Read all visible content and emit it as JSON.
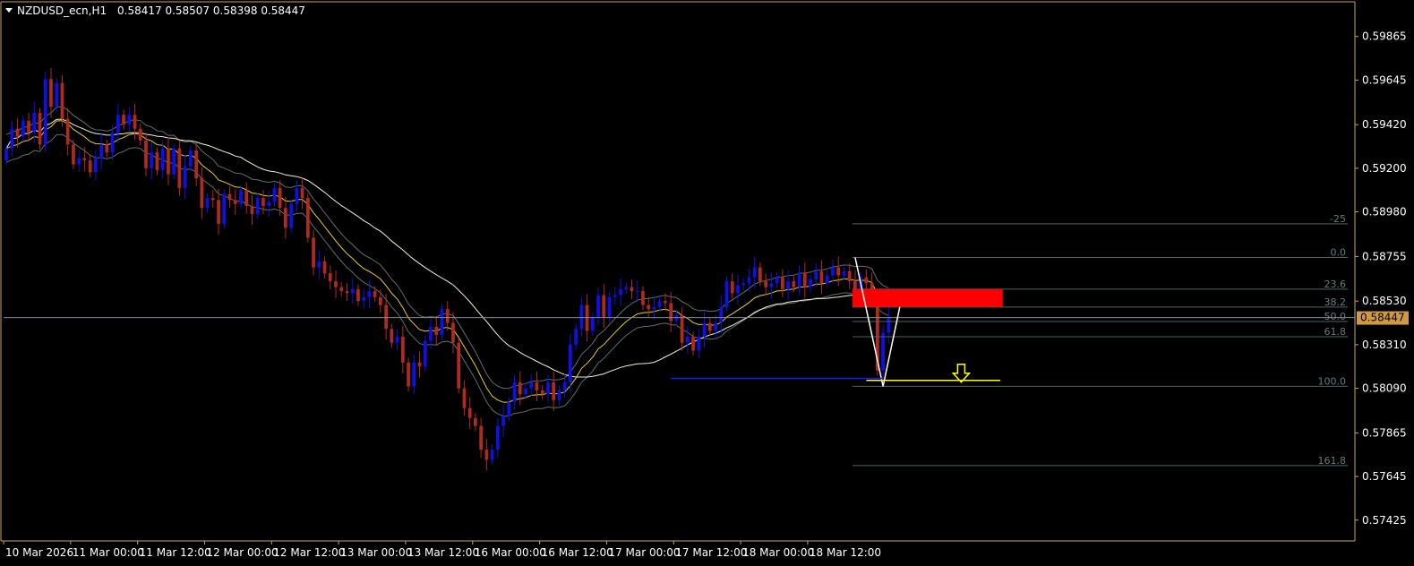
{
  "header": {
    "symbol": "NZDUSD_ecn,H1",
    "ohlc": "0.58417 0.58507 0.58398 0.58447"
  },
  "current_price_label": "0.58447",
  "colors": {
    "background": "#000000",
    "frame": "#c8a85a",
    "bull_candle": "#1010e6",
    "bear_candle": "#b02a22",
    "ma_fast": "#e8cf1e",
    "ma_slow": "#f3f0d8",
    "band": "#5f6f6a",
    "fib": "#4d6666",
    "zone": "#ff0000",
    "arrow": "#ffff00",
    "range_line": "#1a1aff",
    "price_tag_bg": "#d09a42"
  },
  "chart_data": {
    "type": "candlestick",
    "title": "NZDUSD_ecn,H1",
    "timeframe": "H1",
    "ylim": [
      0.5732,
      0.6004
    ],
    "y_ticks": [
      "0.59865",
      "0.59645",
      "0.59420",
      "0.59200",
      "0.58980",
      "0.58755",
      "0.58530",
      "0.58310",
      "0.58090",
      "0.57865",
      "0.57645",
      "0.57425"
    ],
    "x_ticks": [
      "10 Mar 2026",
      "11 Mar 00:00",
      "11 Mar 12:00",
      "12 Mar 00:00",
      "12 Mar 12:00",
      "13 Mar 00:00",
      "13 Mar 12:00",
      "16 Mar 00:00",
      "16 Mar 12:00",
      "17 Mar 00:00",
      "17 Mar 12:00",
      "18 Mar 00:00",
      "18 Mar 12:00"
    ],
    "x_tick_bars": [
      0,
      12,
      24,
      36,
      48,
      60,
      72,
      84,
      96,
      108,
      120,
      132,
      144
    ],
    "closes": [
      0.593,
      0.594,
      0.5936,
      0.5944,
      0.5938,
      0.5948,
      0.5932,
      0.5965,
      0.5951,
      0.5963,
      0.5945,
      0.5932,
      0.5922,
      0.5925,
      0.5924,
      0.5918,
      0.5925,
      0.5932,
      0.5928,
      0.5938,
      0.5947,
      0.5942,
      0.5947,
      0.594,
      0.5934,
      0.592,
      0.5928,
      0.5919,
      0.593,
      0.5917,
      0.593,
      0.591,
      0.5921,
      0.5929,
      0.5915,
      0.59,
      0.5905,
      0.5904,
      0.5892,
      0.5907,
      0.5904,
      0.5902,
      0.5909,
      0.5901,
      0.5897,
      0.5905,
      0.5901,
      0.5903,
      0.591,
      0.59,
      0.589,
      0.5902,
      0.591,
      0.5905,
      0.5885,
      0.587,
      0.5873,
      0.5867,
      0.5863,
      0.586,
      0.5858,
      0.5857,
      0.5859,
      0.5853,
      0.5855,
      0.5858,
      0.5855,
      0.5851,
      0.5839,
      0.5832,
      0.5835,
      0.5822,
      0.581,
      0.5822,
      0.582,
      0.5833,
      0.584,
      0.5836,
      0.5849,
      0.5842,
      0.5832,
      0.5809,
      0.5799,
      0.5794,
      0.579,
      0.5778,
      0.5773,
      0.5778,
      0.579,
      0.5795,
      0.5802,
      0.5812,
      0.5806,
      0.5809,
      0.5812,
      0.5808,
      0.5806,
      0.5812,
      0.5803,
      0.5808,
      0.5812,
      0.5831,
      0.5839,
      0.5851,
      0.5838,
      0.5845,
      0.5856,
      0.5845,
      0.5855,
      0.5856,
      0.5859,
      0.586,
      0.5858,
      0.5858,
      0.5851,
      0.5849,
      0.585,
      0.5853,
      0.5852,
      0.5843,
      0.5846,
      0.5832,
      0.5835,
      0.5828,
      0.5835,
      0.5842,
      0.5838,
      0.5842,
      0.585,
      0.5863,
      0.5857,
      0.5861,
      0.5862,
      0.5865,
      0.587,
      0.5863,
      0.586,
      0.5862,
      0.5865,
      0.5859,
      0.5863,
      0.586,
      0.5867,
      0.586,
      0.5864,
      0.5868,
      0.5862,
      0.5866,
      0.587,
      0.5866,
      0.5868,
      0.5863,
      0.5859,
      0.5865,
      0.5862,
      0.5856,
      0.5818,
      0.5837,
      0.5845
    ],
    "bar_count_visible_area": 242,
    "current_price": 0.58447,
    "fibonacci": [
      {
        "level": "-25",
        "price": 0.5892
      },
      {
        "level": "0.0",
        "price": 0.5875
      },
      {
        "level": "23.6",
        "price": 0.5859
      },
      {
        "level": "38.2",
        "price": 0.585
      },
      {
        "level": "50.0",
        "price": 0.58427
      },
      {
        "level": "61.8",
        "price": 0.5835
      },
      {
        "level": "100.0",
        "price": 0.581
      },
      {
        "level": "161.8",
        "price": 0.577
      }
    ],
    "sell_zone": {
      "price_high": 0.5859,
      "price_low": 0.585
    },
    "swing_line": {
      "from_price": 0.5875,
      "low_price": 0.581,
      "to_price": 0.585
    },
    "low_marker_price": 0.5814,
    "arrow_price": 0.5813,
    "grid": false
  }
}
